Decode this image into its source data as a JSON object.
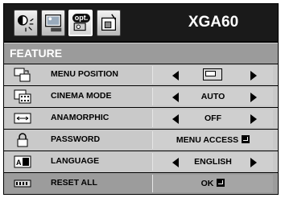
{
  "model": "XGA60",
  "tabs": [
    {
      "icon": "picture-adjust-icon",
      "active": false
    },
    {
      "icon": "image-screen-icon",
      "active": false
    },
    {
      "icon": "option-icon",
      "label": "opt.",
      "active": true
    },
    {
      "icon": "setup-icon",
      "active": false
    }
  ],
  "section_title": "FEATURE",
  "menu": [
    {
      "label": "MENU POSITION",
      "icon": "menu-position-icon",
      "value": "",
      "value_icon": "menu-position-indicator-icon",
      "arrows": true
    },
    {
      "label": "CINEMA MODE",
      "icon": "cinema-mode-icon",
      "value": "AUTO",
      "arrows": true
    },
    {
      "label": "ANAMORPHIC",
      "icon": "anamorphic-icon",
      "value": "OFF",
      "arrows": true
    },
    {
      "label": "PASSWORD",
      "icon": "lock-icon",
      "value": "MENU ACCESS",
      "enter": true,
      "arrows": false
    },
    {
      "label": "LANGUAGE",
      "icon": "language-icon",
      "value": "ENGLISH",
      "arrows": true
    },
    {
      "label": "RESET ALL",
      "icon": "reset-icon",
      "value": "OK",
      "enter": true,
      "arrows": false
    }
  ],
  "colors": {
    "background": "#000000",
    "header": "#9b9b9b",
    "row": "#c9c9c9",
    "last_row": "#9c9c9c"
  }
}
